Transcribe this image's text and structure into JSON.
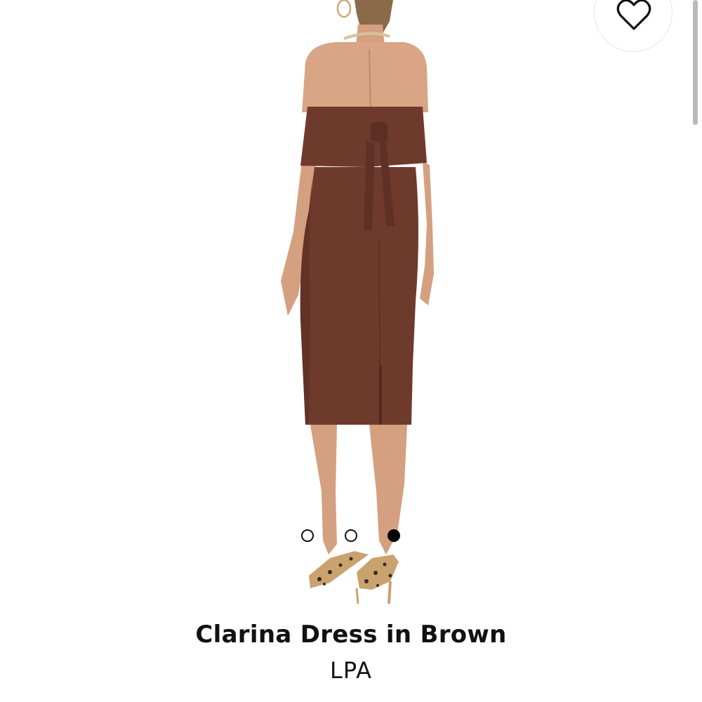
{
  "product": {
    "title": "Clarina Dress in Brown",
    "brand": "LPA",
    "image_alt": "Model wearing brown off-shoulder midi dress, back view"
  },
  "carousel": {
    "count": 3,
    "active_index": 2
  },
  "icons": {
    "favorite": "heart-outline-icon"
  },
  "colors": {
    "dress": "#6e3a2c",
    "dress_shade": "#5c2f24",
    "skin": "#d9a585",
    "accent": "#111111",
    "background": "#ffffff"
  }
}
